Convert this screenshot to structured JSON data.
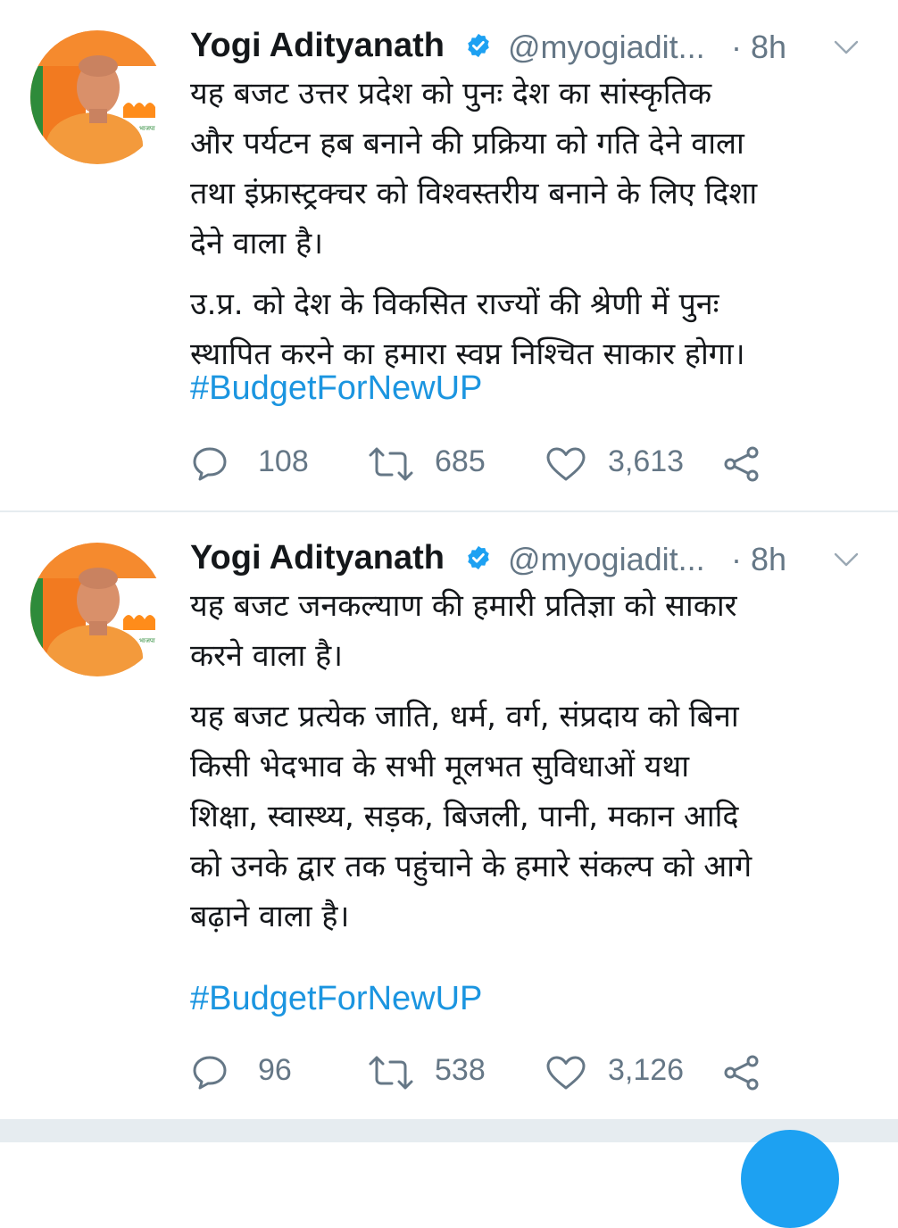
{
  "colors": {
    "accent": "#1da1f2",
    "hashtag": "#1b95e0",
    "muted": "#657786",
    "text": "#14171a",
    "divider": "#e6ecf0",
    "avatar_orange": "#f27a20"
  },
  "tweets": [
    {
      "author": {
        "name": "Yogi Adityanath",
        "handle": "@myogiadit...",
        "verified_icon": "verified-badge-icon",
        "time": "· 8h"
      },
      "lines": [
        "यह बजट उत्तर प्रदेश को पुनः देश का सांस्कृतिक",
        "और पर्यटन हब बनाने की प्रक्रिया को गति देने वाला",
        "तथा इंफ्रास्ट्रक्चर को विश्वस्तरीय बनाने के लिए दिशा",
        "देने वाला है।",
        "उ.प्र. को देश के विकसित राज्यों की श्रेणी में पुनः",
        "स्थापित करने का हमारा स्वप्न निश्चित साकार होगा।"
      ],
      "hashtag": "#BudgetForNewUP",
      "stats": {
        "replies": "108",
        "retweets": "685",
        "likes": "3,613"
      }
    },
    {
      "author": {
        "name": "Yogi Adityanath",
        "handle": "@myogiadit...",
        "verified_icon": "verified-badge-icon",
        "time": "· 8h"
      },
      "lines": [
        "यह बजट जनकल्याण की हमारी प्रतिज्ञा को साकार",
        "करने वाला है।",
        "यह बजट प्रत्येक जाति, धर्म, वर्ग, संप्रदाय को बिना",
        "किसी भेदभाव के सभी मूलभत सुविधाओं यथा",
        "शिक्षा, स्वास्थ्य, सड़क, बिजली, पानी, मकान आदि",
        "को उनके द्वार तक पहुंचाने के हमारे संकल्प को आगे",
        "बढ़ाने वाला है।"
      ],
      "hashtag": "#BudgetForNewUP",
      "stats": {
        "replies": "96",
        "retweets": "538",
        "likes": "3,126"
      }
    }
  ]
}
